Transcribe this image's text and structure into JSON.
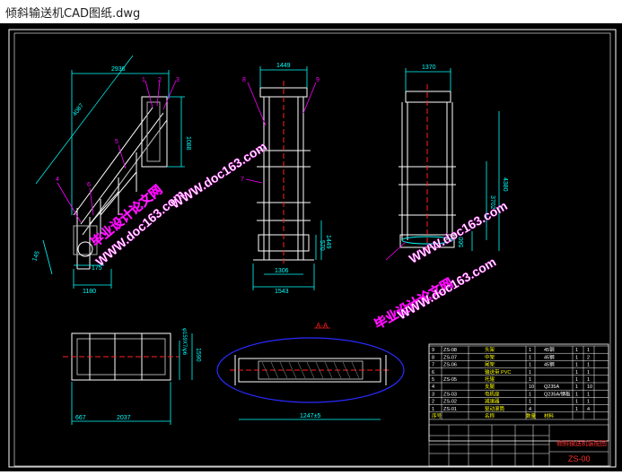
{
  "window": {
    "title": "倾斜输送机CAD图纸.dwg"
  },
  "colors": {
    "background": "#000000",
    "frame": "#ffffff",
    "dim": "#00ffff",
    "leader": "#ff00ff",
    "watermark": "#ffffff",
    "table_text": "#ffff00",
    "title_block": "#ff3030",
    "ellipse": "#2a2aff",
    "marker": "#ff2020"
  },
  "drawing": {
    "side_view": {
      "dim_top": "2936",
      "dim_length": "4087",
      "dim_height": "1088",
      "dim_angle": "145",
      "dim_leg": "175",
      "dim_bottom": "1180",
      "callouts": [
        "1",
        "2",
        "3",
        "4",
        "5",
        "6"
      ]
    },
    "front_view": {
      "dim_top": "1449",
      "dim_base_inner": "1306",
      "dim_base_outer": "1543",
      "dim_side_a": "1449",
      "dim_side_b": "570",
      "callouts": [
        "8",
        "9",
        "7"
      ]
    },
    "end_view": {
      "dim_top": "1370",
      "dim_height": "4380",
      "dim_mid": "3702",
      "dim_low": "560"
    },
    "plan_view": {
      "dim_left": "667",
      "dim_length": "2037",
      "dim_width": "1590",
      "dim_dia": "φ159X7/φ6"
    },
    "section": {
      "marker": "A-A",
      "dim_bottom": "1247±5"
    },
    "watermark": {
      "line1": "毕业设计论文网",
      "line2": "WWW.doc163.com"
    },
    "table": {
      "rows": [
        {
          "no": "9",
          "code": "ZS-08",
          "name": "头架",
          "qty": "1",
          "mat": "45钢",
          "w1": "1",
          "w2": "1"
        },
        {
          "no": "8",
          "code": "ZS-07",
          "name": "中架",
          "qty": "1",
          "mat": "45钢",
          "w1": "1",
          "w2": "2"
        },
        {
          "no": "7",
          "code": "ZS-06",
          "name": "尾架",
          "qty": "1",
          "mat": "45钢",
          "w1": "1",
          "w2": "1"
        },
        {
          "no": "6",
          "code": "",
          "name": "输送带 PVC",
          "qty": "1",
          "mat": "",
          "w1": "1",
          "w2": "1"
        },
        {
          "no": "5",
          "code": "ZS-05",
          "name": "托辊",
          "qty": "1",
          "mat": "",
          "w1": "1",
          "w2": "1"
        },
        {
          "no": "4",
          "code": "",
          "name": "支腿",
          "qty": "10",
          "mat": "Q235A",
          "w1": "1",
          "w2": "10"
        },
        {
          "no": "3",
          "code": "ZS-03",
          "name": "电机座",
          "qty": "1",
          "mat": "Q235A/钢板",
          "w1": "1",
          "w2": "1"
        },
        {
          "no": "2",
          "code": "ZS-02",
          "name": "减速器",
          "qty": "1",
          "mat": "",
          "w1": "1",
          "w2": "1"
        },
        {
          "no": "1",
          "code": "ZS-01",
          "name": "驱动滚筒",
          "qty": "4",
          "mat": "",
          "w1": "1",
          "w2": "4"
        }
      ],
      "header": {
        "no": "序号",
        "name": "名称",
        "qty": "数量",
        "mat": "材料"
      },
      "title_block": {
        "name": "倾斜输送机装配图",
        "code": "ZS-00"
      }
    }
  }
}
